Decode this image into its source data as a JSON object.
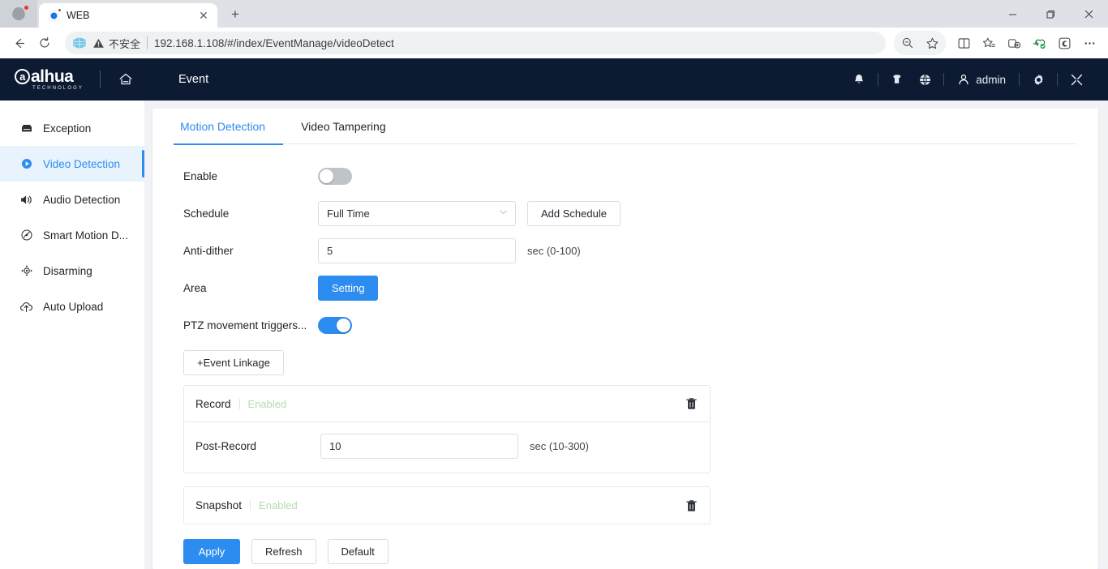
{
  "browser": {
    "tab": {
      "title": "WEB",
      "favicon": "blue-circle-favicon",
      "close": "✕"
    },
    "new_tab_label": "+",
    "window_controls": {
      "minimize": "—",
      "restore": "❐",
      "close": "✕"
    },
    "nav": {
      "back": "←",
      "reload": "↻"
    },
    "omnibox": {
      "security_label": "不安全",
      "url": "192.168.1.108/#/index/EventManage/videoDetect"
    },
    "toolbar_icons": [
      "zoom-out-icon",
      "favorite-star-icon",
      "split-screen-icon",
      "favorites-list-icon",
      "collections-icon",
      "browser-essentials-icon",
      "copilot-icon",
      "more-options-icon"
    ]
  },
  "appbar": {
    "brand": "alhua",
    "brand_mark": "a",
    "brand_sub": "TECHNOLOGY",
    "home_icon": "home-icon",
    "title": "Event",
    "icons": [
      "bell-icon",
      "shield-icon",
      "globe-icon",
      "gear-icon",
      "fullscreen-icon"
    ],
    "user": "admin"
  },
  "sidebar": {
    "items": [
      {
        "label": "Exception",
        "icon": "exception-icon",
        "active": false
      },
      {
        "label": "Video Detection",
        "icon": "video-detection-icon",
        "active": true
      },
      {
        "label": "Audio Detection",
        "icon": "audio-detection-icon",
        "active": false
      },
      {
        "label": "Smart Motion D...",
        "icon": "smart-motion-icon",
        "active": false
      },
      {
        "label": "Disarming",
        "icon": "disarming-icon",
        "active": false
      },
      {
        "label": "Auto Upload",
        "icon": "auto-upload-icon",
        "active": false
      }
    ]
  },
  "tabs": [
    {
      "label": "Motion Detection",
      "active": true
    },
    {
      "label": "Video Tampering",
      "active": false
    }
  ],
  "form": {
    "enable": {
      "label": "Enable",
      "on": false
    },
    "schedule": {
      "label": "Schedule",
      "value": "Full Time",
      "chevron": "⌄",
      "add_button": "Add Schedule"
    },
    "anti_dither": {
      "label": "Anti-dither",
      "value": "5",
      "hint": "sec (0-100)"
    },
    "area": {
      "label": "Area",
      "button": "Setting"
    },
    "ptz": {
      "label": "PTZ movement triggers...",
      "on": true
    },
    "event_linkage_button": "+Event Linkage"
  },
  "linkage_cards": [
    {
      "title": "Record",
      "state": "Enabled",
      "delete_icon": "trash-icon",
      "field": {
        "label": "Post-Record",
        "value": "10",
        "hint": "sec (10-300)"
      }
    },
    {
      "title": "Snapshot",
      "state": "Enabled",
      "delete_icon": "trash-icon",
      "field": null
    }
  ],
  "actions": {
    "apply": "Apply",
    "refresh": "Refresh",
    "default": "Default"
  },
  "colors": {
    "accent": "#2d8cf0",
    "appbar_bg": "#0c1b32",
    "active_item_bg": "#e9f3fd",
    "enabled_text": "#b5dcae"
  }
}
